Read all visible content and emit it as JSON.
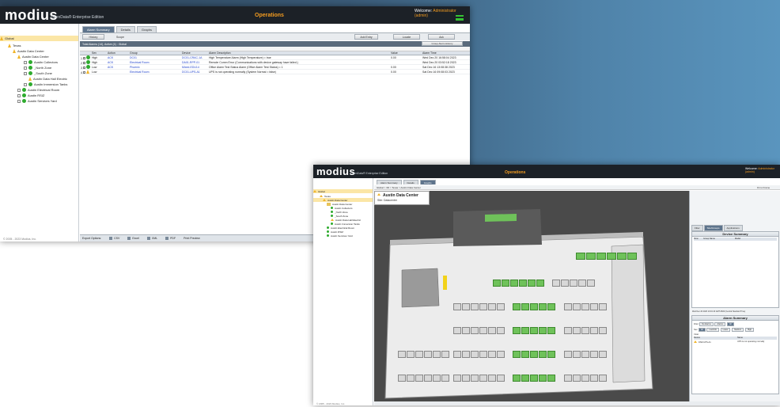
{
  "app": {
    "logo": "modius",
    "edition": "OpenData® Enterprise Edition",
    "title": "Operations",
    "welcome_prefix": "Welcome:",
    "welcome_user": "Administrator (admin)"
  },
  "tree": {
    "root": "Global",
    "items": [
      "Texas",
      "Austin Data Center",
      "Austin Data Center",
      "Austin Collectors",
      "_North Zone",
      "_South Zone",
      "Austin Data Hall Electric",
      "Austin Immersion Tanks",
      "Austin Electrical Room",
      "Austin RSIZ",
      "Austin Services Yard"
    ],
    "footer": "© 2005 - 2023 Modius, Inc."
  },
  "window1": {
    "tabs": [
      "Alarm Summary",
      "Details",
      "Graphs"
    ],
    "toolbar": {
      "history": "History",
      "scope_label": "Scope",
      "buttons": [
        "Add Entry",
        "Locate",
        "Ack"
      ]
    },
    "header": "Total Alarms (14), Active (4) : Global",
    "group_history": "Group Alarm History",
    "columns": [
      "",
      "Sev",
      "Action",
      "Group",
      "Device",
      "Alarm Description",
      "Value",
      "Alarm Time"
    ],
    "rows": [
      {
        "n": "1",
        "sev": "High",
        "action": "ACK",
        "group": "DC01",
        "device": "DC01-CRAC-1A",
        "desc": "High Temperature Alarm (High Temperature) = true",
        "value": "0.00",
        "time": "Wed Dec 20 16:58:04 2023",
        "color": "green"
      },
      {
        "n": "2",
        "sev": "High",
        "action": "ACK",
        "group": "Electrical Room",
        "device": "DA01-RPP-01",
        "desc": "Remote Comm Error (Communications with device gateway have failed.)",
        "value": "",
        "time": "Wed Dec 20 03:52:18 2023",
        "color": "green"
      },
      {
        "n": "3",
        "sev": "Low",
        "action": "ACK",
        "group": "Phoenix",
        "device": "Mixed-EDU14",
        "desc": "Office Alarm Test Status Alarm (Office Alarm Test Status) = 1",
        "value": "0.00",
        "time": "Sat Dec 16 13:08:38 2023",
        "color": "green"
      },
      {
        "n": "4",
        "sev": "Low",
        "action": "",
        "group": "Electrical Room",
        "device": "DC01-UPS-A1",
        "desc": "UPS is not operating normally (System Normal = false)",
        "value": "0.00",
        "time": "Sat Dec 16 09:08:03 2023",
        "color": "yellow"
      }
    ],
    "export_label": "Export Options:",
    "export_buttons": [
      "CSV",
      "Excel",
      "XML",
      "PDF",
      "Print Preview"
    ]
  },
  "window2": {
    "tabs": [
      "Alarm Summary",
      "Details",
      "Graphs"
    ],
    "breadcrumb": "Global > 3D > Texas > Austin Data Center",
    "zoom": "Fit to Frame",
    "location_title": "Austin Data Center",
    "location_sub": "Site: Datacenter",
    "right_tabs": [
      "Filter",
      "Site/Groups",
      "Applications"
    ],
    "device_summary": {
      "title": "Device Summary",
      "columns": [
        "View",
        "Group Name",
        "Model"
      ]
    },
    "timestamp": "Wed Dec 20 2023 10:19:16 GMT-0600 (Central Standard Time)",
    "alarm_summary": {
      "title": "Alarm Summary",
      "filter_label": "Filter:",
      "filter_buttons": [
        "No Alarms",
        "Alarms",
        "All"
      ],
      "sev_label": "Sev:",
      "sev_buttons": [
        "All",
        "Low/Info",
        "Lower",
        "Medium",
        "High"
      ],
      "clear": "Clear",
      "columns": [
        "Device",
        "Name"
      ],
      "row": {
        "device": "DSR-UPS-A1",
        "name": "UPS is not operating normally"
      }
    }
  }
}
